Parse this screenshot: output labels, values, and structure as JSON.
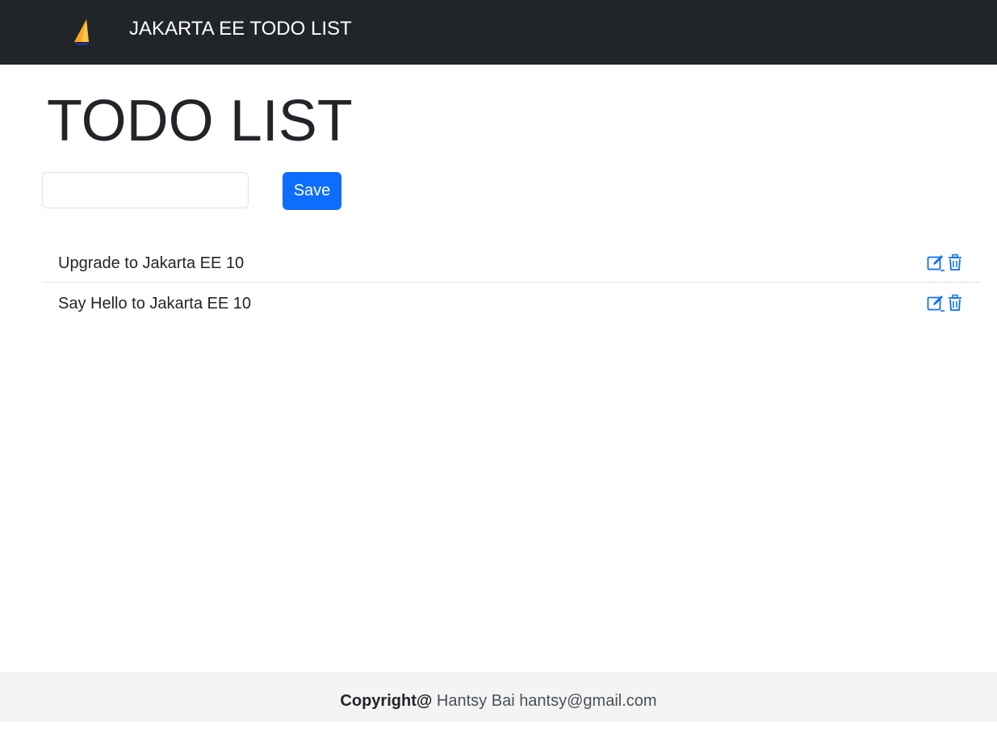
{
  "navbar": {
    "logo": "jakarta-sailboat-logo",
    "title": "JAKARTA EE TODO LIST"
  },
  "main": {
    "page_title": "TODO LIST",
    "input": {
      "value": "",
      "placeholder": ""
    },
    "save_label": "Save",
    "todos": [
      {
        "text": "Upgrade to Jakarta EE 10",
        "actions": [
          "edit-icon",
          "trash-icon"
        ]
      },
      {
        "text": "Say Hello to Jakarta EE 10",
        "actions": [
          "edit-icon",
          "trash-icon"
        ]
      }
    ]
  },
  "footer": {
    "copyright_label": "Copyright@",
    "author": "Hantsy Bai hantsy@gmail.com"
  },
  "colors": {
    "navbar_bg": "#212529",
    "primary": "#0d6efd",
    "footer_bg": "#f4f4f4"
  }
}
